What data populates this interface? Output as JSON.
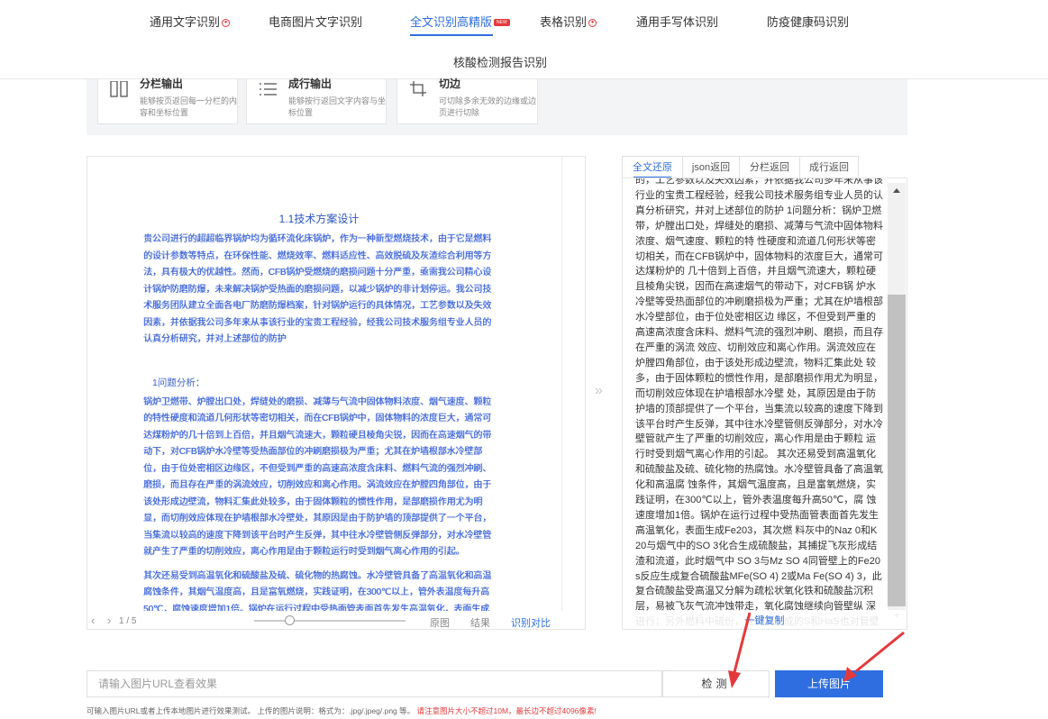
{
  "nav": {
    "tabs": [
      {
        "label": "通用文字识别",
        "hot": true
      },
      {
        "label": "电商图片文字识别",
        "hot": false
      },
      {
        "label": "全文识别高精版",
        "badge": "NEW",
        "active": true
      },
      {
        "label": "表格识别",
        "hot": true
      },
      {
        "label": "通用手写体识别",
        "hot": false
      },
      {
        "label": "防疫健康码识别",
        "hot": false
      },
      {
        "label": "核酸检测报告识别",
        "hot": false
      }
    ],
    "hot_mark": "hot"
  },
  "features": [
    {
      "icon": "columns-icon",
      "title": "分栏输出",
      "desc": "能够按页返回每一分栏的内容和坐标位置"
    },
    {
      "icon": "list-lines-icon",
      "title": "成行输出",
      "desc": "能够按行返回文字内容与坐标位置"
    },
    {
      "icon": "crop-icon",
      "title": "切边",
      "desc": "可切除多余无效的边缘或边页进行切除"
    }
  ],
  "preview": {
    "heading": "1.1技术方案设计",
    "para1": "贵公司进行的超超临界锅炉均为循环流化床锅炉，作为一种新型燃烧技术，由于它是燃料的设计参数等特点，在环保性能、燃烧效率、燃料适应性、高效脱硫及灰渣综合利用等方法，具有极大的优越性。然而，CFB锅炉受燃烧的磨损问题十分严重，亟需我公司精心设计锅炉防磨防爆，未来解决锅炉受热面的磨损问题，以减少锅炉的非计划停运。我公司技术服务团队建立全面各电厂防磨防爆档案，针对锅炉运行的具体情况，工艺参数以及失效因素，并依据我公司多年来从事该行业的宝贵工程经验，经我公司技术服务组专业人员的认真分析研究，并对上述部位的防护",
    "subhead": "1问题分析：",
    "para2": "锅炉卫燃带、炉膛出口处，焊缝处的磨损、减薄与气流中固体物料浓度、烟气速度、颗粒的特性硬度和流道几何形状等密切相关，而在CFB锅炉中，固体物料的浓度巨大，通常可达煤粉炉的几十倍到上百倍，并且烟气流速大，颗粒硬且棱角尖锐，因而在高速烟气的带动下，对CFB锅炉水冷壁等受热面部位的冲刷磨损极为严重；尤其在炉墙根部水冷壁部位，由于位处密相区边缘区，不但受到严重的高速高浓度含床料、燃料气流的强烈冲刷、磨损，而且存在严重的涡流效应，切削效应和离心作用。涡流效应在炉膛四角部位，由于该处形成边壁流，物料汇集此处较多，由于固体颗粒的惯性作用，是部磨损作用尤为明显，而切削效应体现在护墙根部水冷壁处，其原因是由于防护墙的顶部提供了一个平台，当集流以较高的速度下降到该平台时产生反弹，其中往水冷壁管侧反弹部分，对水冷壁管就产生了严重的切削效应，离心作用是由于颗粒运行时受到烟气离心作用的引起。",
    "para3": "其次还易受到高温氧化和硫酸盐及硫、硫化物的热腐蚀。水冷壁管具备了高温氧化和高温腐蚀条件，其烟气温度高，且是富氧燃烧，实践证明，在300℃以上，管外表温度每升高50℃，腐蚀速度增加1倍。锅炉在运行过程中受热面管表面首先发生高温氧化，表面生成Fe2O3，其次燃料灰中的Na2O和K2O与烟气中的SO3化合生成硫酸盐，其捕捉飞灰形成结渣和流道，此时烟气中SO3与M SO4同管壁上的Fe2O3反应生成复合硫酸盐",
    "page_indicator": "1 / 5",
    "btn_original": "原图",
    "btn_result": "结果",
    "btn_compare": "识别对比"
  },
  "result": {
    "tabs": [
      "全文还原",
      "json返回",
      "分栏返回",
      "成行返回"
    ],
    "text": "的，工艺参数以及失效因素，并依据我公司多年来从事该行业的宝贵工程经验，经我公司技术服务组专业人员的认真分析研究，并对上述部位的防护 1问题分析：锅炉卫燃带，炉膛出口处，焊缝处的磨损、减薄与气流中固体物料浓度、烟气速度、颗粒的特 性硬度和流道几何形状等密切相关，而在CFB锅炉中，固体物料的浓度巨大，通常可达煤粉炉的 几十倍到上百倍，并且烟气流速大，颗粒硬且棱角尖锐，因而在高速烟气的带动下，对CFB锅 炉水冷壁等受热面部位的冲刷磨损极为严重；尤其在炉墙根部水冷壁部位，由于位处密相区边 缘区，不但受到严重的高速高浓度含床料、燃料气流的强烈冲刷、磨损，而且存在严重的涡流 效应、切削效应和离心作用。涡流效应在炉膛四角部位，由于该处形成边壁流，物料汇集此处 较多，由于固体颗粒的惯性作用，是部磨损作用尤为明显，而切削效应体现在护墙根部水冷壁 处，其原因是由于防护墙的顶部提供了一个平台，当集流以较高的速度下降到该平台时产生反弹，其中往水冷壁管侧反弹部分，对水冷壁管就产生了严重的切削效应，离心作用是由于颗粒 运行时受到烟气离心作用的引起。 其次还易受到高温氧化和硫酸盐及硫、硫化物的热腐蚀。水冷壁管具备了高温氧化和高温腐 蚀条件，其烟气温度高，且是富氧燃烧，实践证明，在300℃以上，管外表温度每升高50℃，腐 蚀速度增加1倍。锅炉在运行过程中受热面管表面首先发生高温氧化，表面生成Fe203，其次燃 料灰中的Naz 0和K 20与烟气中的SO 3化合生成硫酸盐，其捕捉飞灰形成结渣和流道，此时烟气中 SO 3与Mz SO 4同管壁上的Fe20s反应生成复合硫酸盐MFe(SO 4) 2或Ma Fe(SO 4) 3，此复合硫酸盐受高温又分解为疏松状氧化铁和硫酸盐沉积层，易被飞灰气流冲蚀带走，氧化腐蚀继续向管壁纵 深进行；另外燃料中硫份，经燃烧生成的S和HaS也对管壁会产生强烈的腐蚀，加速管壁减薄，",
    "copy_label": "一键复制"
  },
  "url_input": {
    "placeholder": "请输入图片URL查看效果"
  },
  "buttons": {
    "detect": "检测",
    "upload": "上传图片"
  },
  "hint": {
    "normal": "可输入图片URL或者上传本地图片进行效果测试。 上传的图片说明：格式为：.jpg/.jpeg/.png 等。",
    "warn": "请注意图片大小不超过10M，最长边不超过4096像素!"
  },
  "colors": {
    "accent": "#2f6ee0",
    "annotation_arrow": "#e4393c"
  }
}
